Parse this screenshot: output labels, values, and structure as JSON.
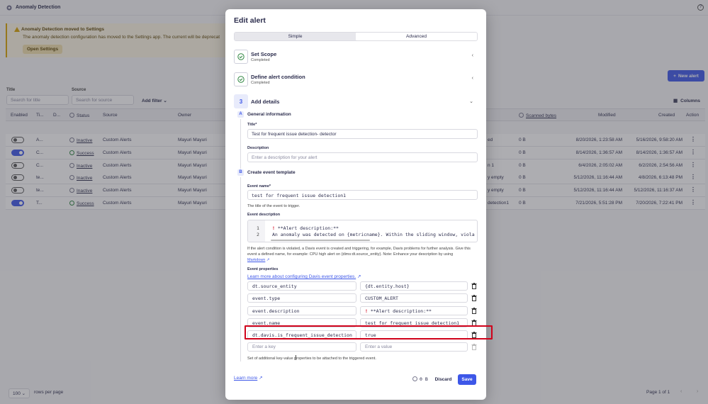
{
  "app": {
    "title": "Anomaly Detection",
    "help_icon": "help-icon"
  },
  "notice": {
    "title": "Anomaly Detection moved to Settings",
    "body": "The anomaly detection configuration has moved to the Settings app. The current will be deprecat",
    "button": "Open Settings"
  },
  "toolbar": {
    "new_alert": "New alert",
    "columns": "Columns"
  },
  "filters": {
    "title_label": "Title",
    "title_placeholder": "Search for title",
    "source_label": "Source",
    "source_placeholder": "Search for source",
    "add_filter": "Add filter"
  },
  "table": {
    "headers": [
      "Enabled",
      "Ti...",
      "D...",
      "Status",
      "Source",
      "Owner",
      "Scanned bytes",
      "Modified",
      "Created",
      "Action"
    ],
    "rows": [
      {
        "enabled": false,
        "title": "A...",
        "status": "Inactive",
        "status_ok": false,
        "source": "Custom Alerts",
        "owner": "Mayuri Mayuri",
        "trunc": "ed",
        "scanned": "0 B",
        "modified": "8/20/2026, 1:23:58 AM",
        "created": "5/16/2026, 9:58:20 AM"
      },
      {
        "enabled": true,
        "title": "C...",
        "status": "Success",
        "status_ok": true,
        "source": "Custom Alerts",
        "owner": "Mayuri Mayuri",
        "trunc": "",
        "scanned": "0 B",
        "modified": "8/14/2026, 1:36:57 AM",
        "created": "8/14/2026, 1:36:57 AM"
      },
      {
        "enabled": false,
        "title": "C...",
        "status": "Inactive",
        "status_ok": false,
        "source": "Custom Alerts",
        "owner": "Mayuri Mayuri",
        "trunc": "n 1",
        "scanned": "0 B",
        "modified": "6/4/2026, 2:05:02 AM",
        "created": "6/2/2026, 2:54:56 AM"
      },
      {
        "enabled": false,
        "title": "te...",
        "status": "Inactive",
        "status_ok": false,
        "source": "Custom Alerts",
        "owner": "Mayuri Mayuri",
        "trunc": "y empty",
        "scanned": "0 B",
        "modified": "5/12/2026, 11:16:44 AM",
        "created": "4/8/2026, 6:13:48 PM"
      },
      {
        "enabled": false,
        "title": "te...",
        "status": "Inactive",
        "status_ok": false,
        "source": "Custom Alerts",
        "owner": "Mayuri Mayuri",
        "trunc": "y empty",
        "scanned": "0 B",
        "modified": "5/12/2026, 11:16:44 AM",
        "created": "5/12/2026, 11:16:37 AM"
      },
      {
        "enabled": true,
        "title": "T...",
        "status": "Success",
        "status_ok": true,
        "source": "Custom Alerts",
        "owner": "Mayuri Mayuri",
        "trunc": "detection1",
        "scanned": "0 B",
        "modified": "7/21/2026, 5:51:28 PM",
        "created": "7/20/2026, 7:22:41 PM"
      }
    ]
  },
  "pagination": {
    "page_size": "100",
    "rows_per_page": "rows per page",
    "page_info": "Page 1 of 1"
  },
  "modal": {
    "title": "Edit alert",
    "tabs": [
      "Simple",
      "Advanced"
    ],
    "steps": [
      {
        "title": "Set Scope",
        "subtitle": "Completed"
      },
      {
        "title": "Define alert condition",
        "subtitle": "Completed"
      },
      {
        "number": "3",
        "title": "Add details"
      }
    ],
    "general": {
      "badge": "A",
      "heading": "General information",
      "title_label": "Title*",
      "title_value": "Test for frequent issue detection- detector",
      "description_label": "Description",
      "description_placeholder": "Enter a description for your alert"
    },
    "event": {
      "badge": "B",
      "heading": "Create event template",
      "name_label": "Event name*",
      "name_value": "test for frequent issue detection1",
      "name_hint": "The title of the event to trigger.",
      "desc_label": "Event description",
      "code_lines": [
        {
          "num": "1",
          "text": "**Alert description:**"
        },
        {
          "num": "2",
          "text": "An anomaly was detected on {metricname}. Within the sliding window, viola"
        }
      ],
      "desc_hint_1": "If the alert condition is violated, a Davis event is created and triggering, for example, Davis problems for further analysis. Give this",
      "desc_hint_2": "event a defined name, for example: CPU high alert on {dims:dt.source_entity}. Note: Enhance your description by using",
      "markdown_link": "Markdown",
      "props_label": "Event properties",
      "props_link": "Learn more about configuring Davis event properties.",
      "properties": [
        {
          "key": "dt.source_entity",
          "value": "{dt.entity.host}"
        },
        {
          "key": "event.type",
          "value": "CUSTOM_ALERT"
        },
        {
          "key": "event.description",
          "value": "**Alert description:**"
        },
        {
          "key": "event.name",
          "value": "test for frequent issue detection1"
        },
        {
          "key": "dt.davis.is_frequent_issue_detection",
          "value": "true"
        }
      ],
      "new_key_placeholder": "Enter a key",
      "new_value_placeholder": "Enter a value",
      "props_hint": "Set of additional key-value properties to be attached to the triggered event."
    },
    "footer": {
      "learn_more": "Learn more",
      "size": "0 B",
      "discard": "Discard",
      "save": "Save"
    }
  }
}
